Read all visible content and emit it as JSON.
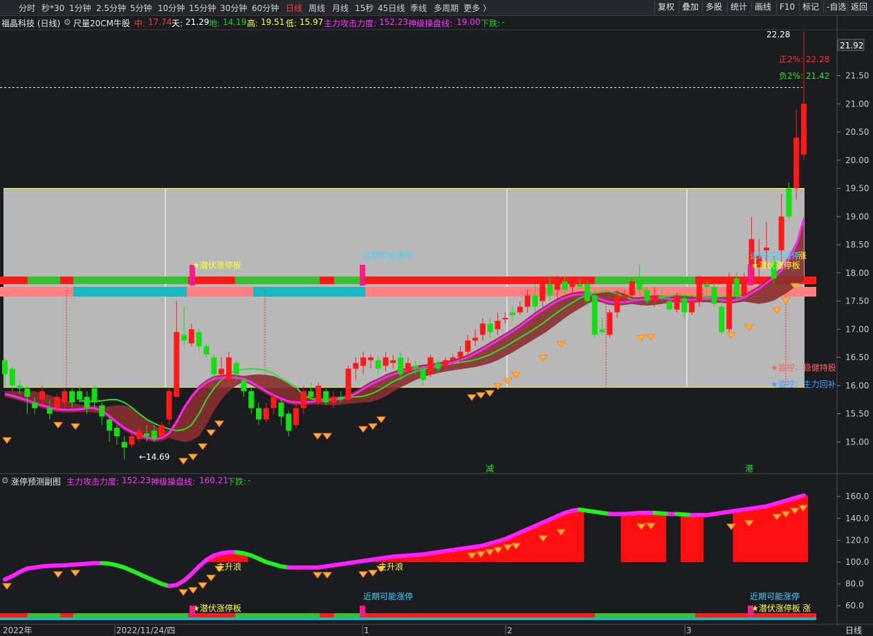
{
  "toolbar": {
    "periods": [
      "分时",
      "秒*30",
      "1分钟",
      "2.5分钟",
      "5分钟",
      "10分钟",
      "15分钟",
      "30分钟",
      "60分钟",
      "日线",
      "周线",
      "月线",
      "15秒",
      "45日线",
      "季线",
      "多周期",
      "更多 〉"
    ],
    "active_period": "日线",
    "right_buttons": [
      "复权",
      "叠加",
      "多股",
      "统计",
      "画线",
      "F10",
      "标记",
      "-自选",
      "返回"
    ]
  },
  "info": {
    "stock": "福晶科技 (日线)",
    "indicator": "尺量20CM牛股",
    "zhong_label": "中:",
    "zhong": "17.74",
    "tian_label": "天:",
    "tian": "21.29",
    "di_label": "地:",
    "di": "14.19",
    "gao_label": "高:",
    "gao": "19.51",
    "di2_label": "低:",
    "di2": "15.97",
    "attack_label": "主力攻击力度:",
    "attack": "152.23",
    "control_label": "神级操盘线:",
    "control": "19.00",
    "down_label": "下跌:",
    "down": "-"
  },
  "main_chart": {
    "price_axis": [
      "21.50",
      "21.00",
      "20.50",
      "20.00",
      "19.50",
      "19.00",
      "18.50",
      "18.00",
      "17.50",
      "17.00",
      "16.50",
      "16.00",
      "15.50",
      "15.00"
    ],
    "current_price": "21.92",
    "high_label": "22.28",
    "low_label": "←14.69",
    "pos_label": "正2%: 22.28",
    "neg_label": "负2%: 21.42",
    "monitor1": "★监控：稳健持股",
    "monitor2": "★监控：主力回补",
    "signal_latent": "★潜伏涨停板",
    "signal_recent": "近期可能涨停",
    "signal_recent_zh": "涨",
    "marker_jian": "减",
    "marker_gang": "港",
    "ma_candles": [
      [
        16.45,
        16.2,
        16.5,
        16.0
      ],
      [
        16.3,
        16.0,
        16.35,
        15.9
      ],
      [
        16.0,
        15.95,
        16.1,
        15.85
      ],
      [
        15.95,
        15.8,
        16.0,
        15.5
      ],
      [
        15.7,
        15.6,
        15.8,
        15.5
      ],
      [
        15.75,
        15.9,
        16.0,
        15.6
      ],
      [
        15.6,
        15.5,
        15.75,
        15.4
      ],
      [
        15.6,
        15.8,
        15.85,
        15.55
      ],
      [
        15.7,
        15.9,
        15.95,
        15.6
      ],
      [
        15.9,
        15.7,
        15.95,
        15.6
      ],
      [
        15.9,
        15.75,
        16.0,
        15.7
      ],
      [
        15.8,
        15.6,
        15.9,
        15.5
      ],
      [
        15.95,
        15.7,
        16.0,
        15.6
      ],
      [
        15.65,
        15.45,
        15.7,
        15.3
      ],
      [
        15.4,
        15.2,
        15.45,
        15.0
      ],
      [
        15.25,
        15.1,
        15.3,
        14.95
      ],
      [
        15.0,
        14.9,
        15.1,
        14.69
      ],
      [
        14.95,
        15.1,
        15.15,
        14.9
      ],
      [
        15.05,
        15.2,
        15.25,
        15.0
      ],
      [
        15.15,
        15.1,
        15.3,
        15.0
      ],
      [
        15.2,
        15.05,
        15.3,
        15.0
      ],
      [
        15.1,
        15.3,
        15.35,
        15.05
      ],
      [
        15.4,
        15.9,
        15.95,
        15.3
      ],
      [
        15.8,
        16.95,
        17.5,
        15.8
      ],
      [
        16.9,
        16.8,
        17.4,
        16.7
      ],
      [
        16.75,
        17.0,
        17.1,
        16.7
      ],
      [
        16.95,
        16.7,
        17.0,
        16.6
      ],
      [
        16.7,
        16.55,
        16.75,
        16.5
      ],
      [
        16.5,
        16.2,
        16.55,
        16.1
      ],
      [
        16.2,
        16.3,
        16.5,
        16.0
      ],
      [
        16.1,
        16.5,
        16.6,
        16.0
      ],
      [
        16.4,
        16.2,
        16.45,
        16.1
      ],
      [
        16.1,
        15.9,
        16.15,
        15.8
      ],
      [
        15.9,
        15.6,
        15.95,
        15.5
      ],
      [
        15.6,
        15.4,
        15.7,
        15.3
      ],
      [
        15.4,
        15.6,
        15.7,
        15.35
      ],
      [
        15.6,
        15.8,
        15.85,
        15.5
      ],
      [
        15.7,
        15.45,
        15.75,
        15.3
      ],
      [
        15.5,
        15.2,
        15.55,
        15.1
      ],
      [
        15.3,
        15.6,
        15.75,
        15.25
      ],
      [
        15.6,
        15.9,
        16.0,
        15.5
      ],
      [
        15.9,
        15.8,
        16.05,
        15.75
      ],
      [
        15.7,
        16.0,
        16.05,
        15.65
      ],
      [
        15.9,
        15.7,
        15.95,
        15.65
      ],
      [
        15.7,
        15.8,
        15.9,
        15.6
      ],
      [
        15.8,
        15.75,
        15.9,
        15.7
      ],
      [
        15.75,
        16.3,
        16.35,
        15.7
      ],
      [
        16.3,
        16.4,
        16.5,
        16.1
      ],
      [
        16.35,
        16.5,
        16.6,
        16.2
      ],
      [
        16.45,
        16.5,
        16.55,
        16.3
      ],
      [
        16.45,
        16.3,
        16.5,
        16.2
      ],
      [
        16.35,
        16.5,
        16.6,
        16.25
      ],
      [
        16.4,
        16.45,
        16.55,
        16.3
      ],
      [
        16.5,
        16.2,
        16.6,
        16.1
      ],
      [
        16.25,
        16.4,
        16.5,
        16.2
      ],
      [
        16.35,
        16.3,
        16.45,
        16.2
      ],
      [
        16.3,
        16.1,
        16.35,
        16.0
      ],
      [
        16.2,
        16.5,
        16.55,
        16.15
      ],
      [
        16.4,
        16.3,
        16.45,
        16.2
      ],
      [
        16.35,
        16.45,
        16.5,
        16.25
      ],
      [
        16.45,
        16.5,
        16.55,
        16.35
      ],
      [
        16.5,
        16.6,
        16.7,
        16.4
      ],
      [
        16.6,
        16.8,
        16.9,
        16.5
      ],
      [
        16.8,
        16.85,
        17.0,
        16.7
      ],
      [
        16.9,
        17.1,
        17.2,
        16.8
      ],
      [
        17.1,
        16.95,
        17.2,
        16.85
      ],
      [
        17.0,
        17.15,
        17.3,
        16.9
      ],
      [
        17.2,
        17.2,
        17.3,
        17.1
      ],
      [
        17.3,
        17.25,
        17.4,
        17.15
      ],
      [
        17.3,
        17.4,
        17.5,
        17.25
      ],
      [
        17.4,
        17.6,
        17.7,
        17.3
      ],
      [
        17.6,
        17.4,
        17.8,
        17.3
      ],
      [
        17.5,
        17.85,
        17.9,
        17.4
      ],
      [
        17.8,
        17.6,
        17.95,
        17.5
      ],
      [
        17.7,
        17.9,
        17.95,
        17.55
      ],
      [
        17.85,
        17.7,
        17.95,
        17.6
      ],
      [
        17.75,
        17.8,
        17.9,
        17.65
      ],
      [
        17.8,
        17.75,
        17.9,
        17.7
      ],
      [
        17.8,
        17.5,
        17.85,
        17.4
      ],
      [
        17.6,
        16.9,
        17.7,
        16.85
      ],
      [
        17.0,
        16.95,
        17.2,
        16.9
      ],
      [
        16.9,
        17.3,
        17.35,
        16.85
      ],
      [
        17.3,
        17.6,
        17.7,
        17.2
      ],
      [
        17.55,
        17.6,
        17.7,
        17.45
      ],
      [
        17.6,
        17.85,
        17.9,
        17.5
      ],
      [
        17.8,
        17.7,
        18.15,
        17.6
      ],
      [
        17.7,
        17.5,
        17.75,
        17.45
      ],
      [
        17.5,
        17.6,
        17.75,
        17.4
      ],
      [
        17.6,
        17.55,
        17.7,
        17.5
      ],
      [
        17.5,
        17.35,
        17.6,
        17.3
      ],
      [
        17.35,
        17.6,
        17.65,
        17.3
      ],
      [
        17.55,
        17.3,
        17.6,
        17.2
      ],
      [
        17.3,
        17.5,
        17.6,
        17.25
      ],
      [
        17.5,
        17.9,
        17.95,
        17.4
      ],
      [
        17.8,
        17.75,
        17.85,
        17.5
      ],
      [
        17.75,
        17.45,
        17.8,
        17.4
      ],
      [
        17.4,
        16.95,
        17.5,
        16.9
      ],
      [
        17.0,
        17.9,
        18.0,
        16.9
      ],
      [
        17.9,
        17.6,
        18.0,
        17.5
      ],
      [
        17.6,
        17.9,
        18.0,
        17.55
      ],
      [
        17.8,
        18.6,
        19.0,
        17.8
      ],
      [
        18.1,
        18.3,
        18.6,
        17.7
      ],
      [
        18.4,
        18.45,
        18.9,
        18.1
      ],
      [
        18.2,
        17.9,
        18.3,
        17.8
      ],
      [
        18.4,
        19.0,
        19.4,
        18.2
      ],
      [
        19.5,
        19.0,
        19.6,
        18.95
      ],
      [
        19.5,
        20.4,
        20.9,
        19.3
      ],
      [
        20.1,
        21.0,
        22.28,
        20.0
      ]
    ],
    "ma_fast": [
      15.85,
      15.82,
      15.78,
      15.74,
      15.69,
      15.65,
      15.61,
      15.58,
      15.57,
      15.57,
      15.58,
      15.6,
      15.6,
      15.55,
      15.46,
      15.35,
      15.25,
      15.18,
      15.12,
      15.08,
      15.05,
      15.07,
      15.15,
      15.35,
      15.6,
      15.8,
      15.95,
      16.05,
      16.12,
      16.14,
      16.15,
      16.14,
      16.12,
      16.06,
      15.98,
      15.9,
      15.83,
      15.77,
      15.72,
      15.7,
      15.7,
      15.71,
      15.73,
      15.74,
      15.75,
      15.76,
      15.8,
      15.86,
      15.94,
      16.02,
      16.08,
      16.15,
      16.2,
      16.24,
      16.27,
      16.3,
      16.32,
      16.34,
      16.36,
      16.38,
      16.41,
      16.45,
      16.5,
      16.57,
      16.64,
      16.72,
      16.8,
      16.88,
      16.96,
      17.05,
      17.15,
      17.25,
      17.34,
      17.42,
      17.5,
      17.56,
      17.6,
      17.62,
      17.62,
      17.58,
      17.52,
      17.48,
      17.47,
      17.48,
      17.5,
      17.52,
      17.54,
      17.55,
      17.55,
      17.54,
      17.53,
      17.52,
      17.52,
      17.53,
      17.54,
      17.54,
      17.52,
      17.5,
      17.52,
      17.56,
      17.64,
      17.72,
      17.82,
      17.92,
      18.05,
      18.25,
      18.5,
      18.95
    ],
    "sub_chart": {
      "axis": [
        "160.0",
        "140.0",
        "120.0",
        "100.0",
        "80.0",
        "60.0"
      ],
      "title": "涨停预测副图",
      "attack_label": "主力攻击力度:",
      "attack": "152.23",
      "control_label": "神级操盘线:",
      "control": "160.21",
      "down_label": "下跌:",
      "down": "-",
      "text_main_up": "主升浪",
      "signal_recent": "近期可能涨停",
      "signal_latent": "★潜伏涨停板",
      "signal_zh": "涨",
      "line": [
        84,
        87,
        91,
        94,
        95,
        96,
        96.5,
        96.8,
        97,
        97.5,
        98,
        98.5,
        99,
        99,
        98.5,
        97,
        95,
        92,
        89,
        86,
        83,
        80,
        78,
        79,
        83,
        89,
        96,
        102,
        106,
        108,
        109,
        109,
        108,
        106,
        103,
        100,
        98,
        96,
        95,
        95,
        95,
        95,
        95,
        96,
        97,
        98,
        99,
        100,
        101,
        102,
        103,
        104,
        105,
        105.5,
        106,
        106.5,
        107,
        108,
        109,
        110,
        111,
        112,
        113,
        114,
        115,
        117,
        119,
        121,
        124,
        127,
        130,
        133,
        136,
        139,
        142,
        145,
        147,
        148,
        147,
        146,
        145,
        144,
        144,
        144,
        144.5,
        145,
        145,
        145,
        144.5,
        144,
        144,
        143.5,
        143,
        143,
        143,
        144,
        145,
        146,
        147,
        148,
        149,
        150,
        151,
        153,
        155,
        157,
        159,
        161
      ]
    },
    "dates": [
      "2022年",
      "2022/11/24/四",
      "1",
      "2",
      "3"
    ],
    "period_label": "日线"
  },
  "colors": {
    "up": "#ff1a1a",
    "down": "#12e012",
    "ma_fast": "#ff22ff",
    "ma_slow": "#28e028",
    "band": "#b8b8b8",
    "bg": "#1b1c20"
  }
}
